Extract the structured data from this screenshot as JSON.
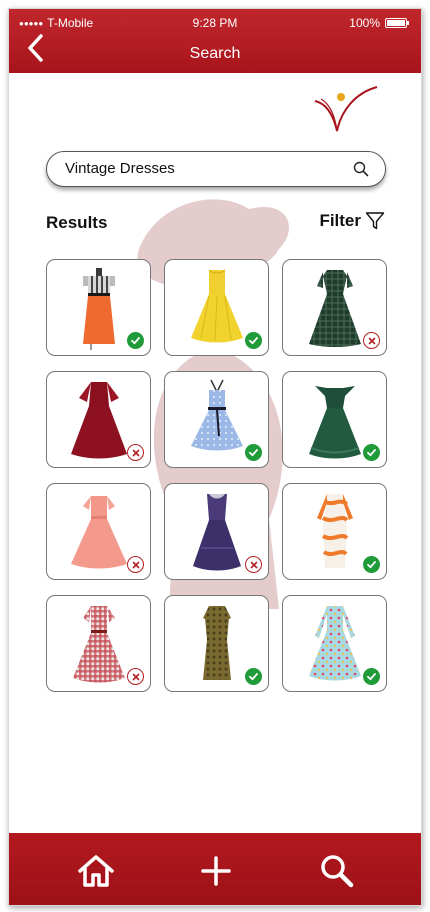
{
  "status_bar": {
    "carrier": "T-Mobile",
    "time": "9:28 PM",
    "battery": "100%"
  },
  "header": {
    "title": "Search"
  },
  "colors": {
    "brand_red": "#b3191f",
    "approved_green": "#1f9b3a",
    "rejected_red": "#b01e24"
  },
  "search": {
    "value": "Vintage Dresses"
  },
  "results": {
    "label": "Results",
    "filter_label": "Filter",
    "items": [
      {
        "name": "striped-top-orange-skirt-dress",
        "status": "approved"
      },
      {
        "name": "yellow-swing-dress",
        "status": "approved"
      },
      {
        "name": "green-plaid-dress",
        "status": "rejected"
      },
      {
        "name": "burgundy-dress",
        "status": "rejected"
      },
      {
        "name": "light-blue-polka-dot-dress",
        "status": "approved"
      },
      {
        "name": "dark-green-lace-dress",
        "status": "approved"
      },
      {
        "name": "pink-swing-dress",
        "status": "rejected"
      },
      {
        "name": "purple-lace-dress",
        "status": "rejected"
      },
      {
        "name": "orange-print-dress",
        "status": "approved"
      },
      {
        "name": "red-gingham-dress",
        "status": "rejected"
      },
      {
        "name": "gold-brocade-dress",
        "status": "approved"
      },
      {
        "name": "floral-blue-dress",
        "status": "approved"
      }
    ]
  },
  "bottom_nav": {
    "icons": [
      "home-icon",
      "plus-icon",
      "search-icon"
    ]
  }
}
